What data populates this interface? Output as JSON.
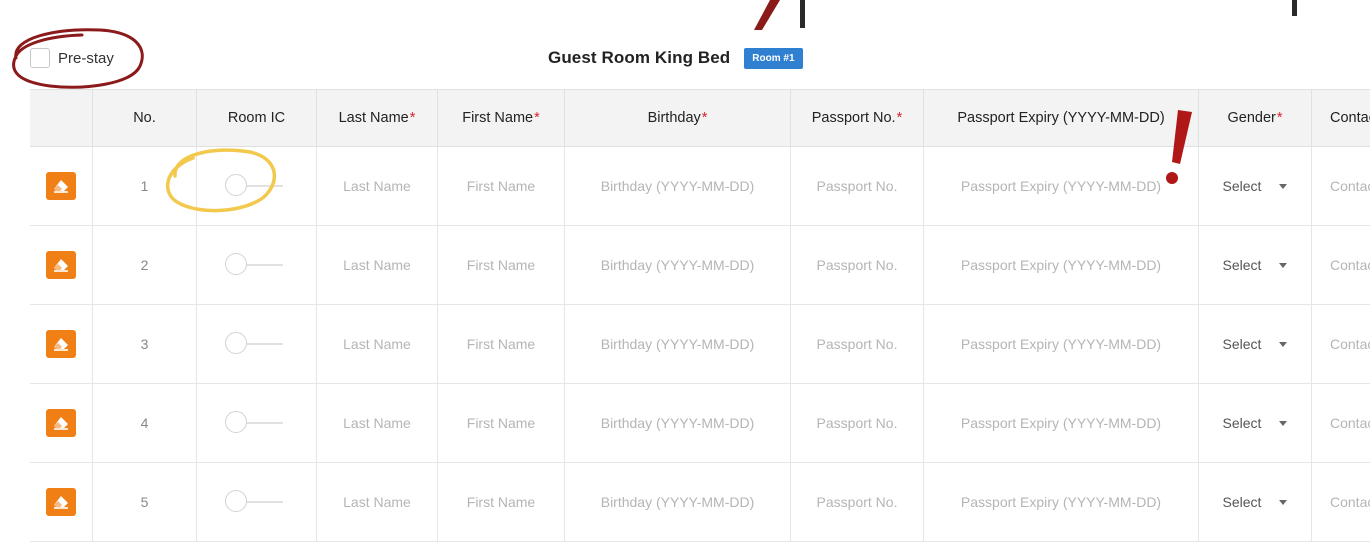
{
  "colors": {
    "accent_blue": "#2f80d1",
    "action_orange": "#f07f16",
    "required_red": "#d9232d",
    "annotation_red": "#8b1a1a",
    "annotation_yellow": "#f2c94c"
  },
  "prestay": {
    "label": "Pre-stay",
    "checked": false
  },
  "room": {
    "title": "Guest Room King Bed",
    "badge": "Room #1"
  },
  "table": {
    "columns": {
      "no": "No.",
      "room_ic": "Room IC",
      "last_name": "Last Name",
      "first_name": "First Name",
      "birthday": "Birthday",
      "passport_no": "Passport No.",
      "passport_expiry": "Passport Expiry (YYYY-MM-DD)",
      "gender": "Gender",
      "contact": "Contact"
    },
    "required_mark": "*",
    "placeholders": {
      "last_name": "Last Name",
      "first_name": "First Name",
      "birthday": "Birthday (YYYY-MM-DD)",
      "passport_no": "Passport No.",
      "passport_expiry": "Passport Expiry (YYYY-MM-DD)",
      "gender": "Select",
      "contact": "Contact"
    },
    "rows": [
      {
        "no": "1",
        "room_ic": false
      },
      {
        "no": "2",
        "room_ic": false
      },
      {
        "no": "3",
        "room_ic": false
      },
      {
        "no": "4",
        "room_ic": false
      },
      {
        "no": "5",
        "room_ic": false
      }
    ]
  },
  "icons": {
    "erase": "eraser-icon",
    "toggle": "toggle-switch-icon",
    "caret": "caret-down-icon",
    "annotation_circle": "circle-annotation-icon",
    "annotation_exclamation": "exclamation-annotation-icon"
  }
}
